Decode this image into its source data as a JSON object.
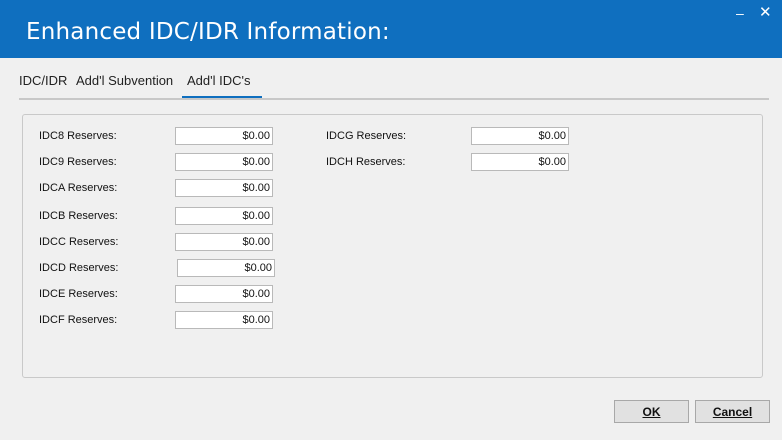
{
  "window": {
    "title": "Enhanced IDC/IDR Information:",
    "minimize": "–",
    "close": "✕"
  },
  "tabs": [
    {
      "label": "IDC/IDR"
    },
    {
      "label": "Add'l Subvention"
    },
    {
      "label": "Add'l IDC's",
      "active": true
    }
  ],
  "fields_left": [
    {
      "label": "IDC8 Reserves:",
      "value": "$0.00"
    },
    {
      "label": "IDC9 Reserves:",
      "value": "$0.00"
    },
    {
      "label": "IDCA Reserves:",
      "value": "$0.00"
    },
    {
      "label": "IDCB Reserves:",
      "value": "$0.00"
    },
    {
      "label": "IDCC Reserves:",
      "value": "$0.00"
    },
    {
      "label": "IDCD Reserves:",
      "value": "$0.00"
    },
    {
      "label": "IDCE Reserves:",
      "value": "$0.00"
    },
    {
      "label": "IDCF Reserves:",
      "value": "$0.00"
    }
  ],
  "fields_right": [
    {
      "label": "IDCG Reserves:",
      "value": "$0.00"
    },
    {
      "label": "IDCH Reserves:",
      "value": "$0.00"
    }
  ],
  "buttons": {
    "ok_label": "OK",
    "cancel_label": "Cancel"
  },
  "colors": {
    "titlebar": "#0f6fbf",
    "tab_underline": "#0f6fbf"
  }
}
